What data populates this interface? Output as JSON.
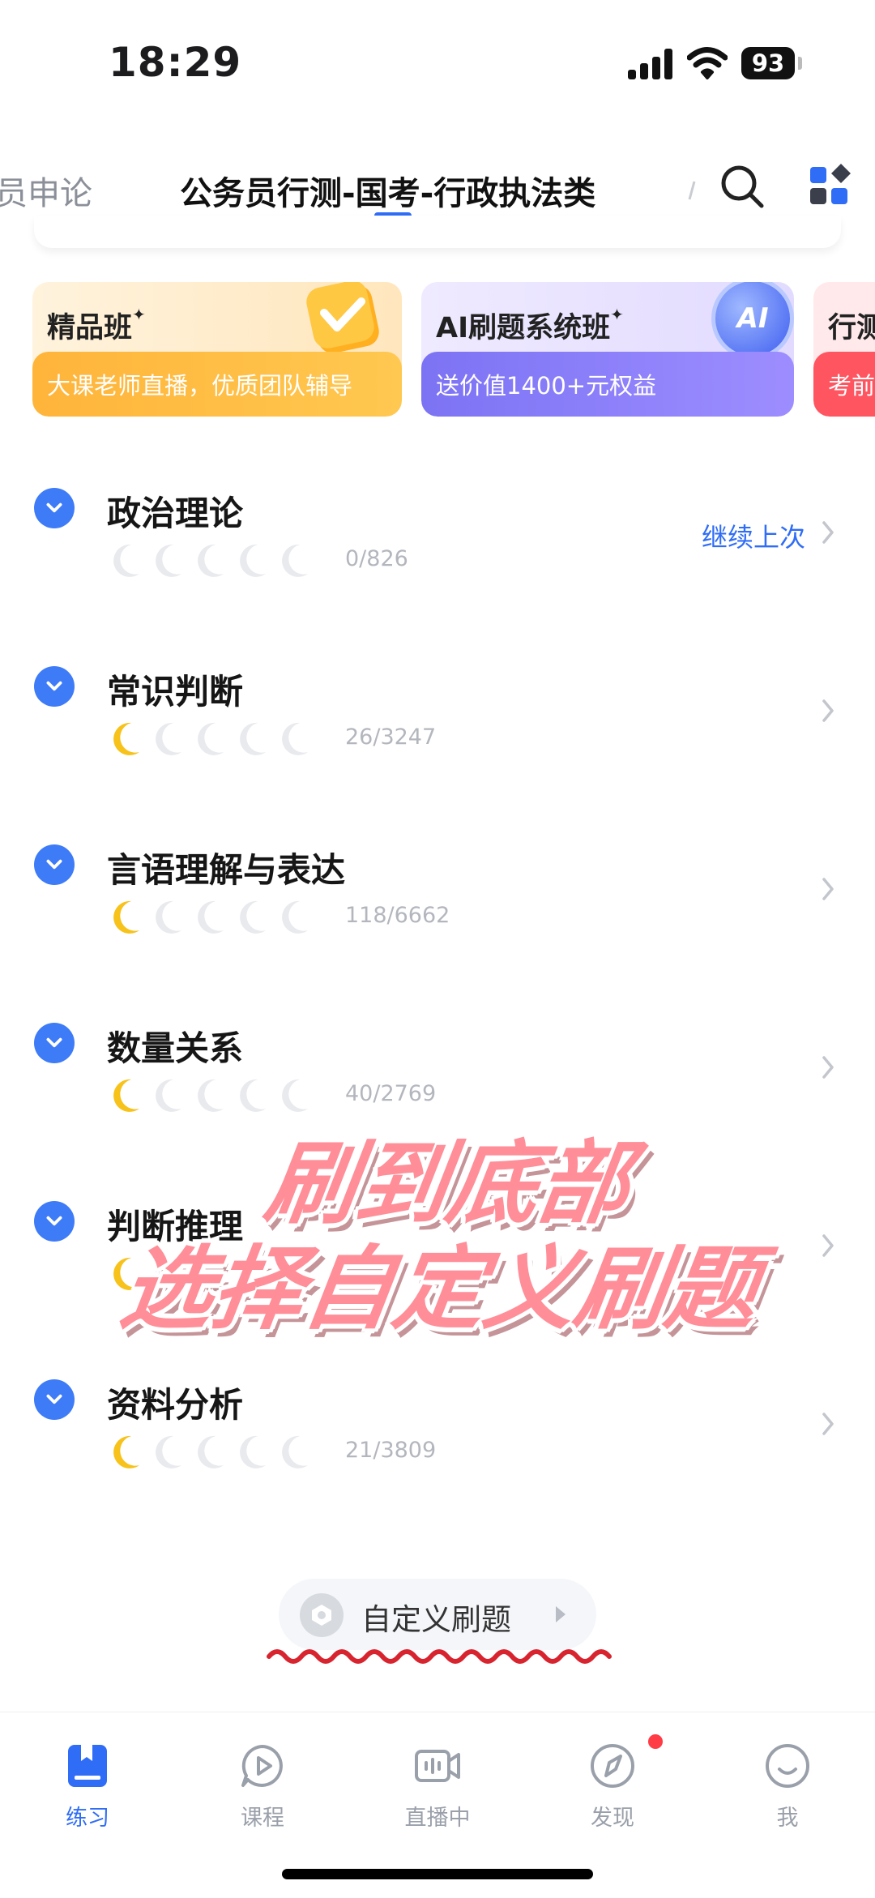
{
  "status_bar": {
    "time": "18:29",
    "battery": "93"
  },
  "header": {
    "tabs": [
      {
        "label": "员申论",
        "active": false
      },
      {
        "label": "公务员行测-国考-行政执法类",
        "active": true
      }
    ]
  },
  "promos": [
    {
      "title": "精品班",
      "subtitle": "大课老师直播，优质团队辅导"
    },
    {
      "title": "AI刷题系统班",
      "subtitle": "送价值1400+元权益",
      "badge": "AI"
    },
    {
      "title": "行测",
      "subtitle": "考前"
    }
  ],
  "categories": [
    {
      "title": "政治理论",
      "count": "0/826",
      "lit_moons": 0,
      "total_moons": 5,
      "action": "继续上次"
    },
    {
      "title": "常识判断",
      "count": "26/3247",
      "lit_moons": 1,
      "total_moons": 5,
      "action": ""
    },
    {
      "title": "言语理解与表达",
      "count": "118/6662",
      "lit_moons": 1,
      "total_moons": 5,
      "action": ""
    },
    {
      "title": "数量关系",
      "count": "40/2769",
      "lit_moons": 1,
      "total_moons": 5,
      "action": ""
    },
    {
      "title": "判断推理",
      "count": "",
      "lit_moons": 1,
      "total_moons": 5,
      "action": ""
    },
    {
      "title": "资料分析",
      "count": "21/3809",
      "lit_moons": 1,
      "total_moons": 5,
      "action": ""
    }
  ],
  "overlay": {
    "line1": "刷到底部",
    "line2": "选择自定义刷题"
  },
  "custom_practice": {
    "label": "自定义刷题"
  },
  "bottom_nav": [
    {
      "label": "练习",
      "icon": "book-icon",
      "active": true
    },
    {
      "label": "课程",
      "icon": "play-bubble-icon",
      "active": false
    },
    {
      "label": "直播中",
      "icon": "live-video-icon",
      "active": false
    },
    {
      "label": "发现",
      "icon": "compass-icon",
      "active": false,
      "badge_dot": true
    },
    {
      "label": "我",
      "icon": "smile-icon",
      "active": false
    }
  ],
  "colors": {
    "accent": "#2f6df6",
    "moon_lit": "#f7c21a",
    "moon_dim": "#e9eaee",
    "overlay_text": "#ff8e98"
  }
}
